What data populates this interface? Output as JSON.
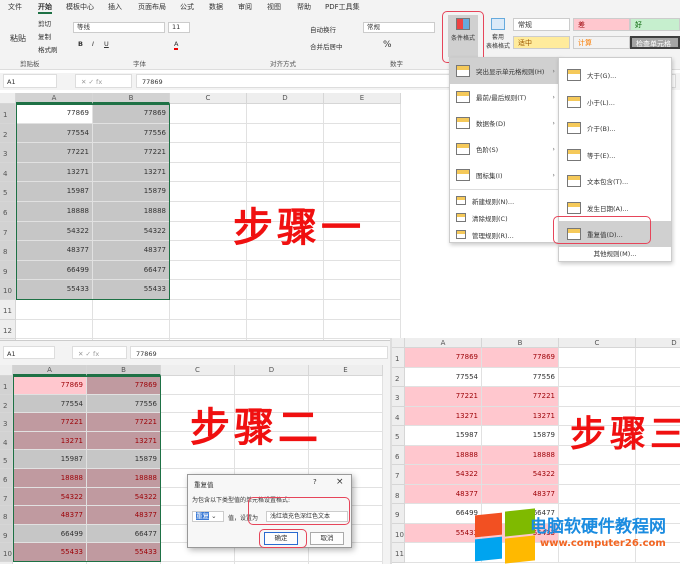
{
  "ribbon": {
    "tabs": [
      "文件",
      "开始",
      "模板中心",
      "插入",
      "页面布局",
      "公式",
      "数据",
      "审阅",
      "视图",
      "帮助",
      "PDF工具集"
    ],
    "paste": "粘贴",
    "cut": "剪切",
    "copy": "复制",
    "format_painter": "格式刷",
    "clipboard_group": "剪贴板",
    "font_name": "等线",
    "font_size": "11",
    "font_group": "字体",
    "wrap_text": "自动换行",
    "merge_center": "合并后居中",
    "align_group": "对齐方式",
    "number_format": "常规",
    "number_group": "数字",
    "cond_format": "条件格式",
    "table_format_1": "套用",
    "table_format_2": "表格格式",
    "styles": {
      "normal": "常规",
      "bad": "差",
      "good": "好",
      "neutral": "适中",
      "calc": "计算",
      "check": "检查单元格"
    }
  },
  "formula_bar": {
    "name_box": "A1",
    "value": "77869",
    "fx": "fx"
  },
  "columns": [
    "A",
    "B",
    "C",
    "D",
    "E"
  ],
  "data": {
    "A": [
      77869,
      77554,
      77221,
      13271,
      15987,
      18888,
      54322,
      48377,
      66499,
      55433
    ],
    "B": [
      77869,
      77556,
      77221,
      13271,
      15879,
      18888,
      54322,
      48377,
      66477,
      55433
    ],
    "duplicate_rows": [
      1,
      3,
      4,
      6,
      7,
      8,
      10
    ]
  },
  "cf_menu": {
    "items": [
      {
        "label": "突出显示单元格规则(H)",
        "sub": true
      },
      {
        "label": "最前/最后规则(T)",
        "sub": true
      },
      {
        "label": "数据条(D)",
        "sub": true
      },
      {
        "label": "色阶(S)",
        "sub": true
      },
      {
        "label": "图标集(I)",
        "sub": true
      }
    ],
    "actions": [
      "新建规则(N)...",
      "清除规则(C)",
      "管理规则(R)..."
    ]
  },
  "highlight_submenu": {
    "items": [
      "大于(G)...",
      "小于(L)...",
      "介于(B)...",
      "等于(E)...",
      "文本包含(T)...",
      "发生日期(A)...",
      "重复值(D)..."
    ],
    "more": "其他规则(M)..."
  },
  "dialog": {
    "title": "重复值",
    "help": "?",
    "close": "×",
    "prompt": "为包含以下类型值的单元格设置格式:",
    "type": "重复",
    "value_label": "值，设置为",
    "format": "浅红填充色深红色文本",
    "ok": "确定",
    "cancel": "取消"
  },
  "steps": {
    "one": "步骤一",
    "two": "步骤二",
    "three": "步骤三"
  },
  "watermark": {
    "title": "电脑软硬件教程网",
    "url": "www.computer26.com"
  },
  "colors": {
    "dup_fill": "#ffc7ce",
    "dup_text": "#9c0006",
    "selection": "#c6c6c6",
    "accent": "#1e7145",
    "step": "#f01010"
  }
}
